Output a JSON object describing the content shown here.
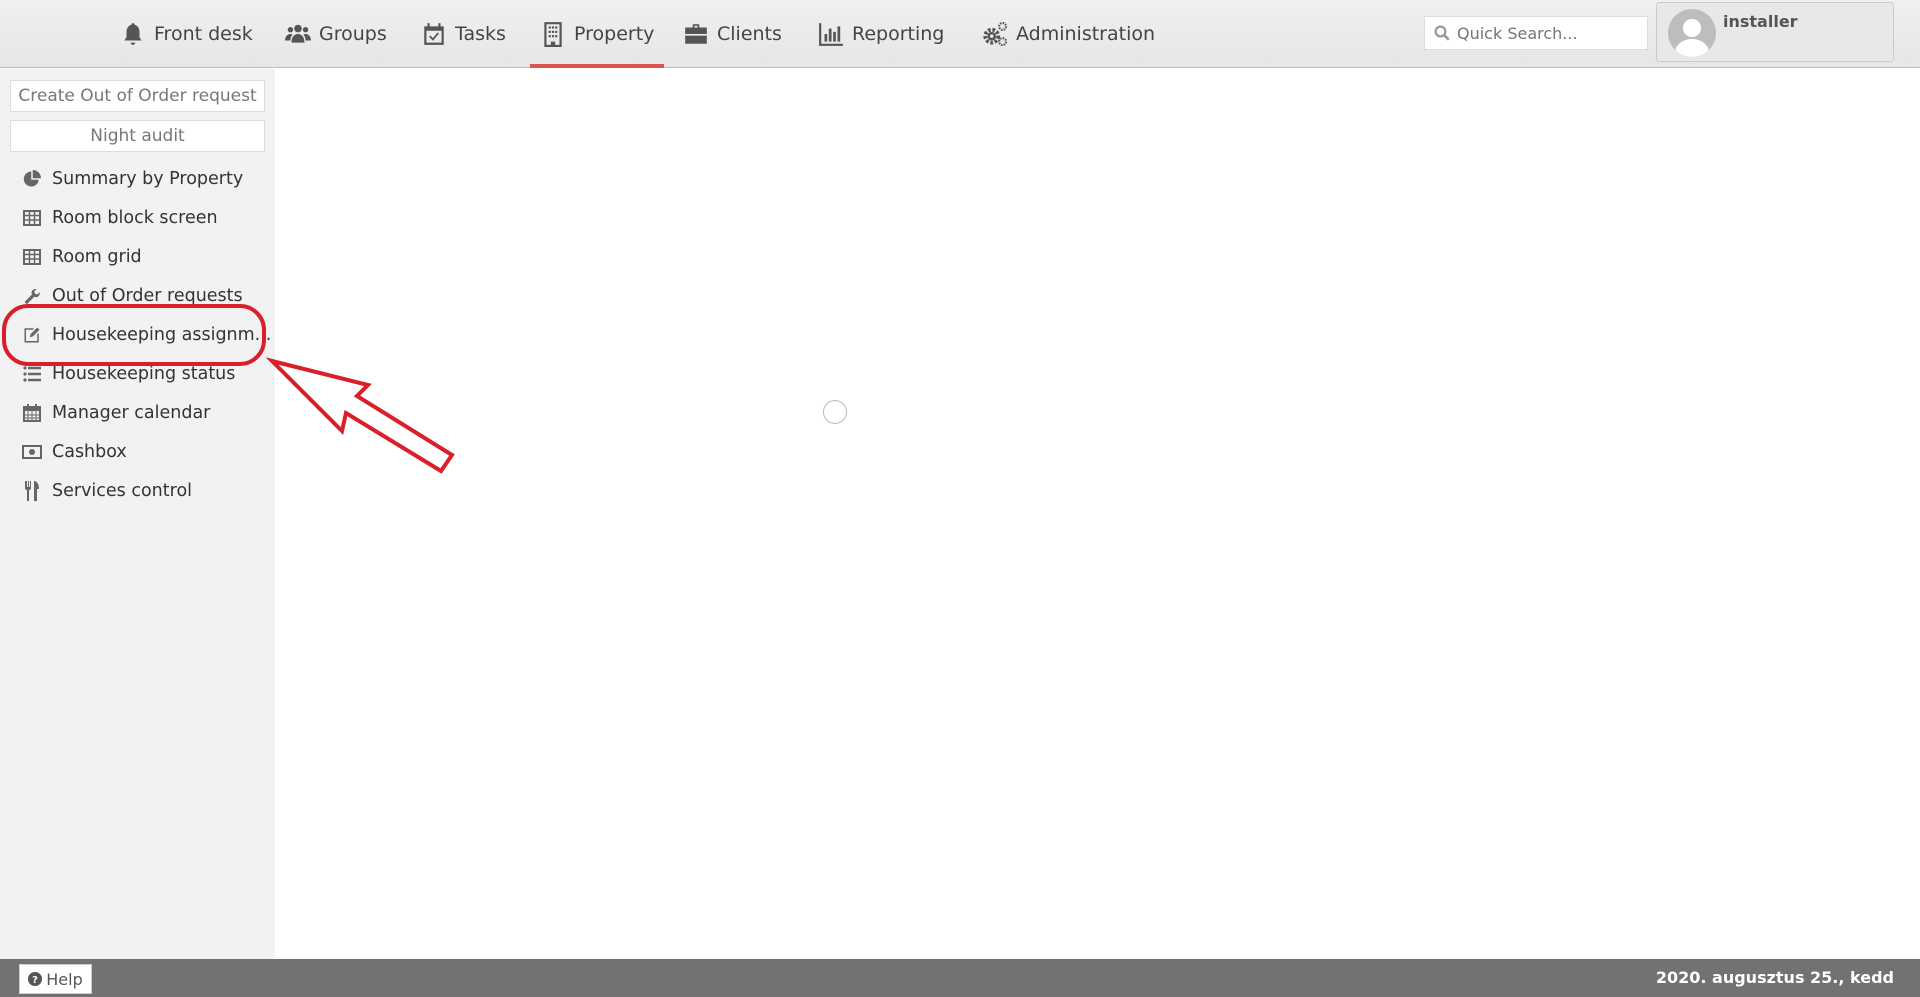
{
  "topnav": {
    "items": [
      {
        "label": "Front desk",
        "icon": "bell-icon"
      },
      {
        "label": "Groups",
        "icon": "users-icon"
      },
      {
        "label": "Tasks",
        "icon": "calendar-check-icon"
      },
      {
        "label": "Property",
        "icon": "building-icon",
        "active": true
      },
      {
        "label": "Clients",
        "icon": "briefcase-icon"
      },
      {
        "label": "Reporting",
        "icon": "bar-chart-icon"
      },
      {
        "label": "Administration",
        "icon": "gears-icon"
      }
    ],
    "active_color": "#d9534f"
  },
  "search": {
    "placeholder": "Quick Search..."
  },
  "user": {
    "name": "installer"
  },
  "sidebar": {
    "buttons": [
      "Create Out of Order request",
      "Night audit"
    ],
    "items": [
      {
        "label": "Summary by Property",
        "icon": "pie-chart-icon"
      },
      {
        "label": "Room block screen",
        "icon": "table-icon"
      },
      {
        "label": "Room grid",
        "icon": "table-icon"
      },
      {
        "label": "Out of Order requests",
        "icon": "wrench-icon"
      },
      {
        "label": "Housekeeping assignm...",
        "icon": "edit-icon"
      },
      {
        "label": "Housekeeping status",
        "icon": "list-icon"
      },
      {
        "label": "Manager calendar",
        "icon": "calendar-icon"
      },
      {
        "label": "Cashbox",
        "icon": "money-icon"
      },
      {
        "label": "Services control",
        "icon": "cutlery-icon"
      }
    ]
  },
  "footer": {
    "help_label": "Help",
    "date": "2020. augusztus 25., kedd"
  },
  "annotation_color": "#d9202a"
}
